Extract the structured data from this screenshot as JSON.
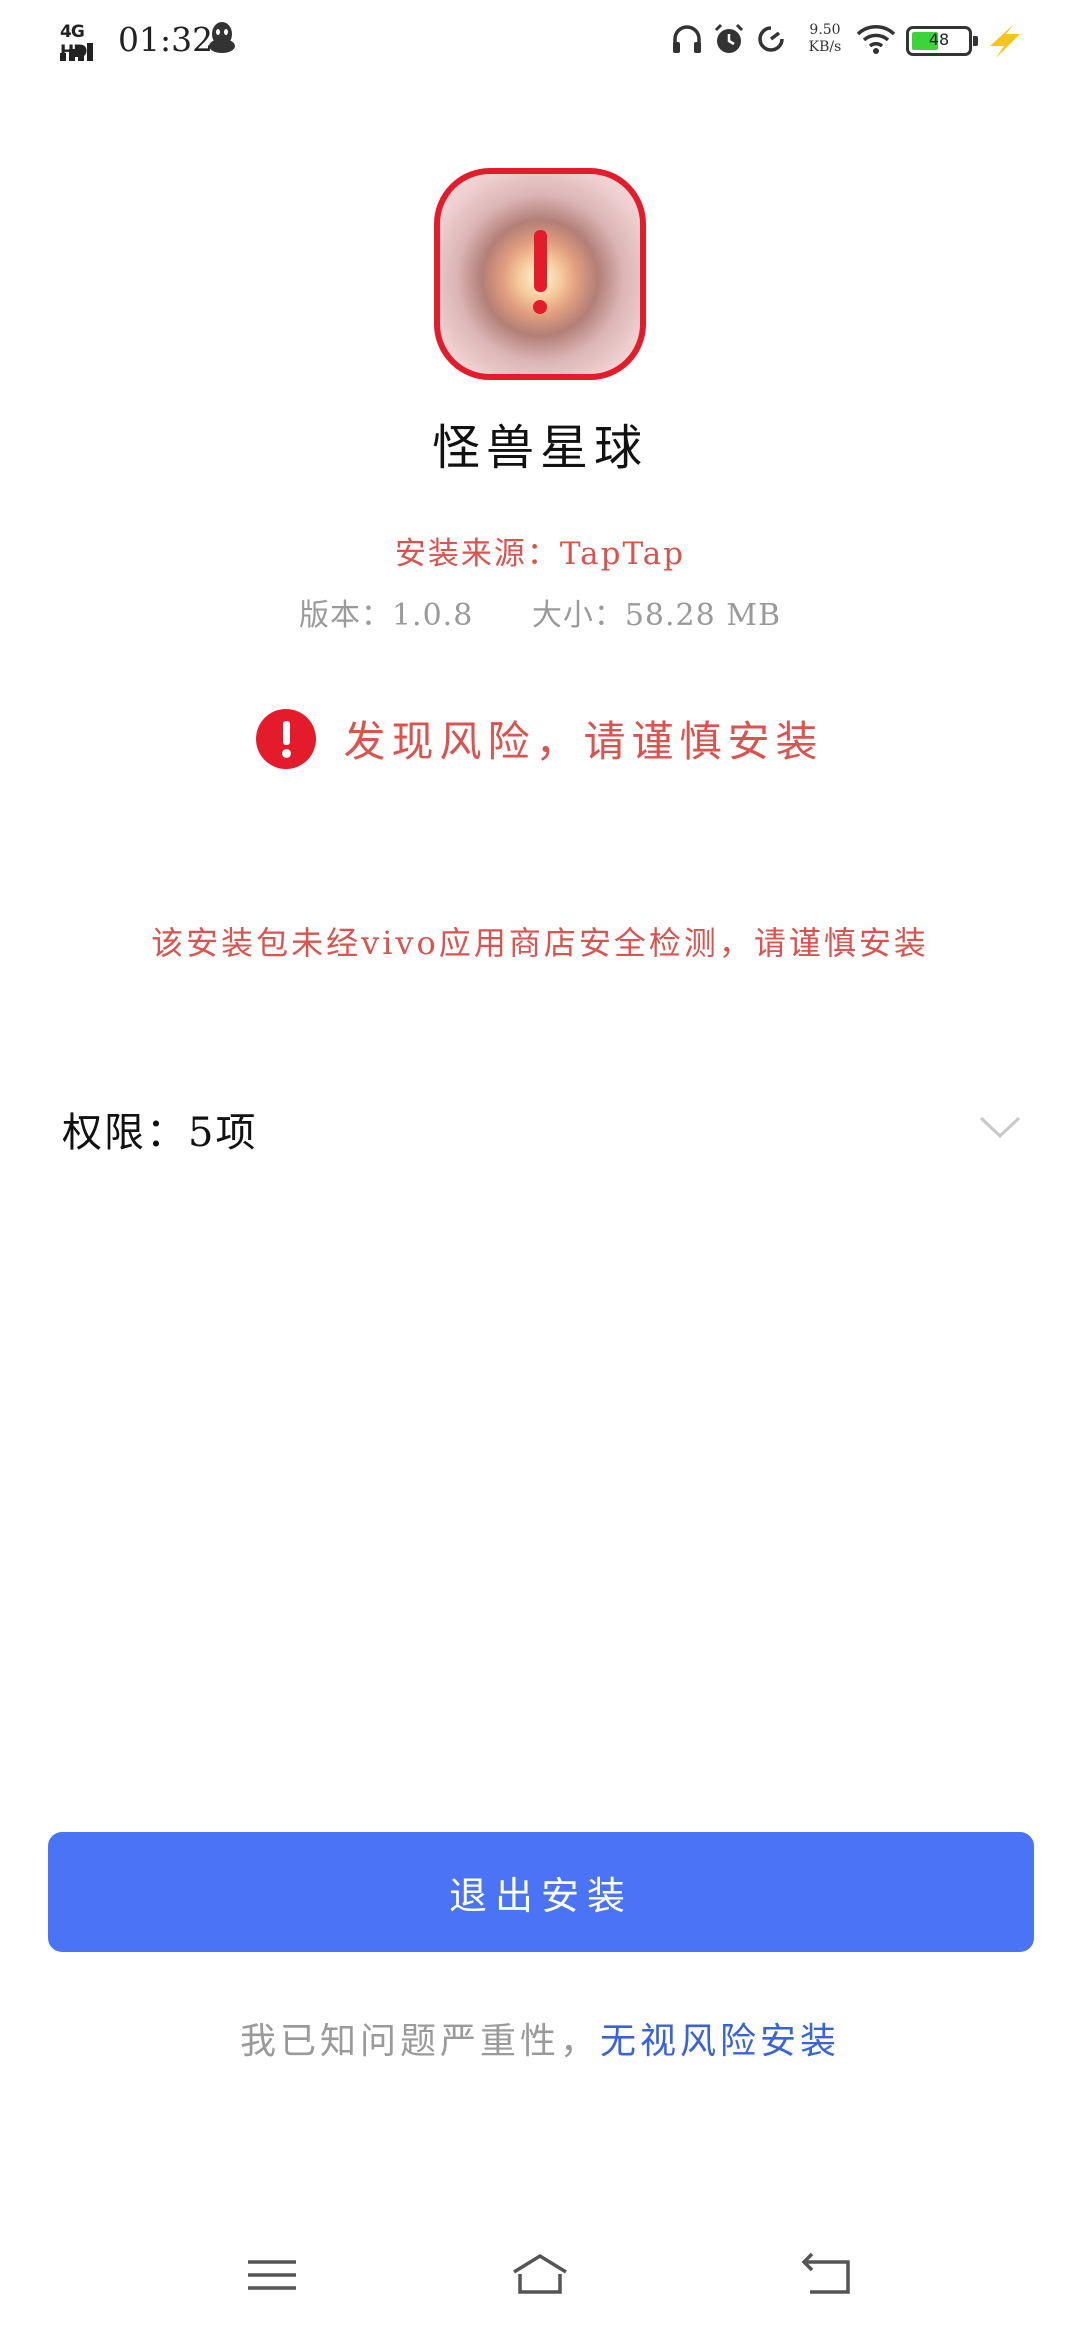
{
  "status_bar": {
    "network": "4G HD",
    "time": "01:32",
    "speed_value": "9.50",
    "speed_unit": "KB/s",
    "battery": "48",
    "battery_fill_fraction": 0.48
  },
  "app": {
    "name": "怪兽星球",
    "source": "安装来源：TapTap",
    "version": "版本：1.0.8",
    "size": "大小：58.28 MB"
  },
  "risk": {
    "title": "发现风险，请谨慎安装",
    "warning": "该安装包未经vivo应用商店安全检测，请谨慎安装"
  },
  "permissions": {
    "label": "权限：5项"
  },
  "actions": {
    "exit_label": "退出安装",
    "ignore_prefix": "我已知问题严重性，",
    "ignore_link": "无视风险安装"
  },
  "colors": {
    "accent_blue": "#4a74f5",
    "link_blue": "#3a63d8",
    "danger_red": "#e41b2a",
    "warning_text": "#d9534f",
    "muted_gray": "#9a9a9a"
  }
}
